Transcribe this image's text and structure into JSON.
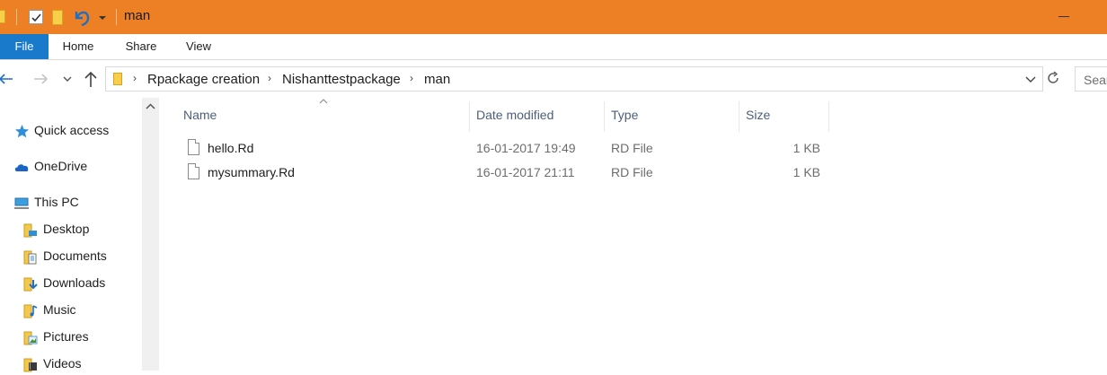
{
  "window": {
    "title": "man"
  },
  "ribbon": {
    "tabs": [
      {
        "label": "File"
      },
      {
        "label": "Home"
      },
      {
        "label": "Share"
      },
      {
        "label": "View"
      }
    ]
  },
  "address": {
    "breadcrumbs": [
      {
        "label": "Rpackage creation"
      },
      {
        "label": "Nishanttestpackage"
      },
      {
        "label": "man"
      }
    ],
    "search_placeholder": "Sear"
  },
  "sidebar": {
    "items": [
      {
        "label": "Quick access",
        "icon": "star-icon"
      },
      {
        "label": "OneDrive",
        "icon": "cloud-icon"
      },
      {
        "label": "This PC",
        "icon": "computer-icon"
      },
      {
        "label": "Desktop",
        "icon": "desktop-folder-icon"
      },
      {
        "label": "Documents",
        "icon": "documents-folder-icon"
      },
      {
        "label": "Downloads",
        "icon": "downloads-folder-icon"
      },
      {
        "label": "Music",
        "icon": "music-folder-icon"
      },
      {
        "label": "Pictures",
        "icon": "pictures-folder-icon"
      },
      {
        "label": "Videos",
        "icon": "videos-folder-icon"
      }
    ]
  },
  "file_list": {
    "columns": [
      {
        "label": "Name"
      },
      {
        "label": "Date modified"
      },
      {
        "label": "Type"
      },
      {
        "label": "Size"
      }
    ],
    "rows": [
      {
        "name": "hello.Rd",
        "date": "16-01-2017 19:49",
        "type": "RD File",
        "size": "1 KB"
      },
      {
        "name": "mysummary.Rd",
        "date": "16-01-2017 21:11",
        "type": "RD File",
        "size": "1 KB"
      }
    ]
  },
  "colors": {
    "titlebar": "#ed8025",
    "file_tab": "#1979ca",
    "column_header": "#4c607a"
  }
}
